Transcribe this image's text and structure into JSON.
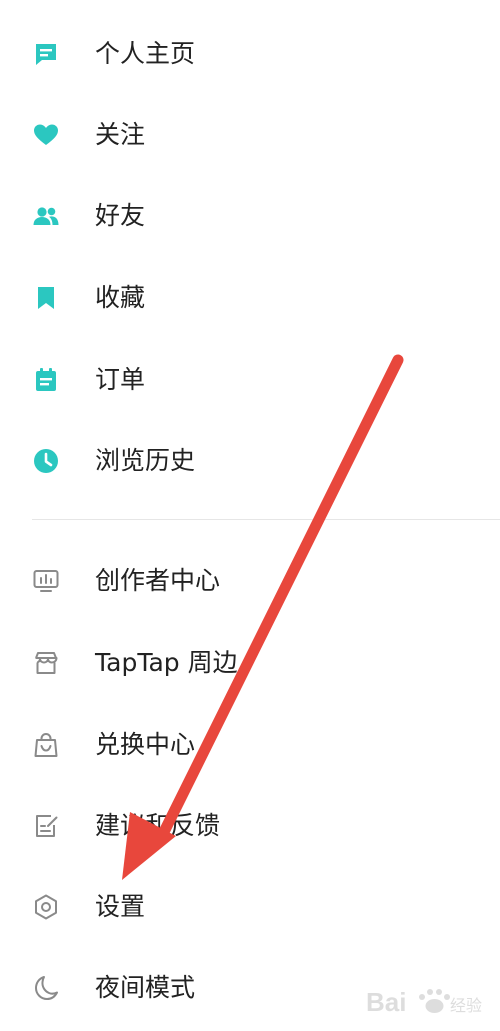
{
  "colors": {
    "accent": "#2bc7c0",
    "icon_gray": "#8a8a8a",
    "text": "#222222",
    "arrow": "#e8473c",
    "divider": "#e6e6e6"
  },
  "menu": {
    "primary_items": [
      {
        "label": "个人主页",
        "icon": "profile-card-icon"
      },
      {
        "label": "关注",
        "icon": "heart-icon"
      },
      {
        "label": "好友",
        "icon": "friends-icon"
      },
      {
        "label": "收藏",
        "icon": "bookmark-icon"
      },
      {
        "label": "订单",
        "icon": "clipboard-icon"
      },
      {
        "label": "浏览历史",
        "icon": "clock-icon"
      }
    ],
    "secondary_items": [
      {
        "label": "创作者中心",
        "icon": "monitor-chart-icon"
      },
      {
        "label": "TapTap 周边",
        "icon": "shop-icon"
      },
      {
        "label": "兑换中心",
        "icon": "shopping-bag-icon"
      },
      {
        "label": "建议和反馈",
        "icon": "edit-note-icon"
      },
      {
        "label": "设置",
        "icon": "settings-hexagon-icon"
      },
      {
        "label": "夜间模式",
        "icon": "moon-icon"
      }
    ]
  }
}
